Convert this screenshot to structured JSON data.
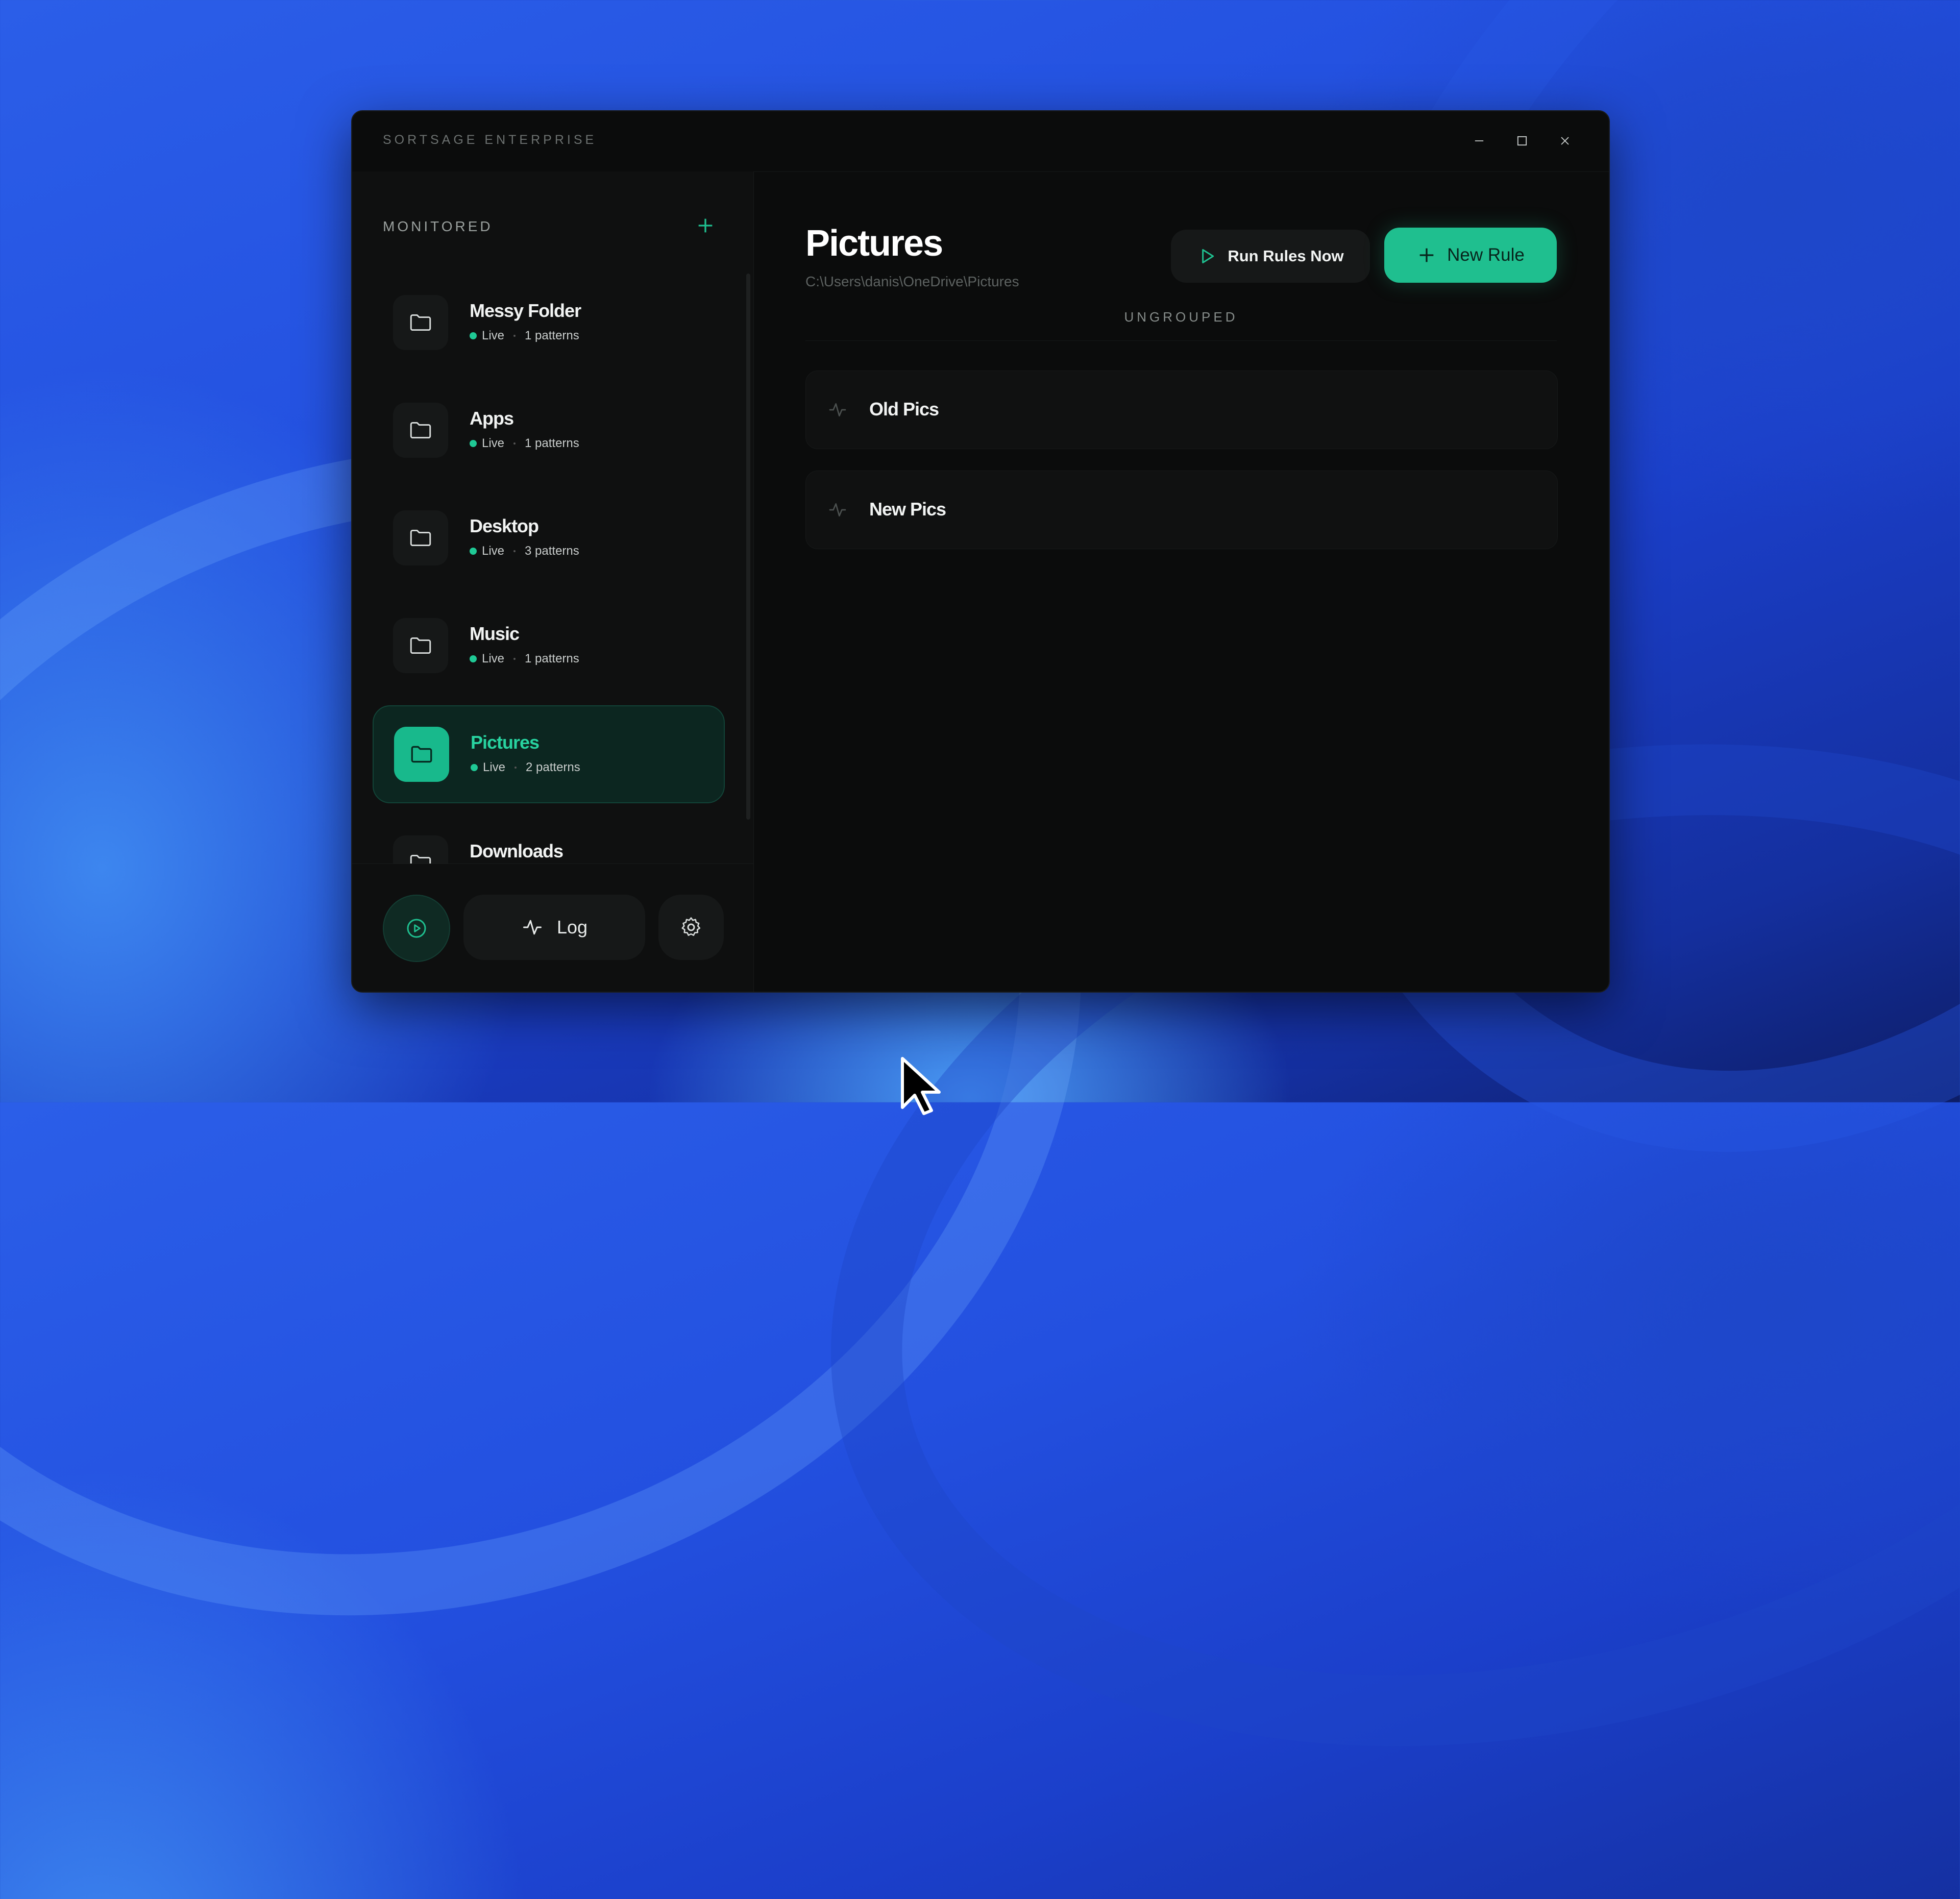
{
  "app": {
    "title": "SORTSAGE ENTERPRISE"
  },
  "window_controls": {
    "minimize_icon": "minimize-icon",
    "maximize_icon": "maximize-icon",
    "close_icon": "close-icon"
  },
  "sidebar": {
    "section_label": "MONITORED",
    "add_icon": "plus-icon",
    "folders": [
      {
        "name": "Messy Folder",
        "status": "Live",
        "patterns": "1 patterns",
        "active": false
      },
      {
        "name": "Apps",
        "status": "Live",
        "patterns": "1 patterns",
        "active": false
      },
      {
        "name": "Desktop",
        "status": "Live",
        "patterns": "3 patterns",
        "active": false
      },
      {
        "name": "Music",
        "status": "Live",
        "patterns": "1 patterns",
        "active": false
      },
      {
        "name": "Pictures",
        "status": "Live",
        "patterns": "2 patterns",
        "active": true
      },
      {
        "name": "Downloads",
        "status": "",
        "patterns": "",
        "active": false
      }
    ],
    "bottom": {
      "play_icon": "play-circle-icon",
      "log_label": "Log",
      "log_icon": "activity-icon",
      "settings_icon": "gear-icon"
    }
  },
  "main": {
    "title": "Pictures",
    "path": "C:\\Users\\danis\\OneDrive\\Pictures",
    "run_button_label": "Run Rules Now",
    "new_rule_button_label": "New Rule",
    "group_label": "UNGROUPED",
    "rules": [
      {
        "name": "Old Pics",
        "icon": "activity-icon"
      },
      {
        "name": "New Pics",
        "icon": "activity-icon"
      }
    ]
  },
  "colors": {
    "accent": "#1fbf8f",
    "window_bg": "#0b0c0c",
    "sidebar_bg": "#0f1010",
    "desktop_blue": "#2350e0"
  }
}
